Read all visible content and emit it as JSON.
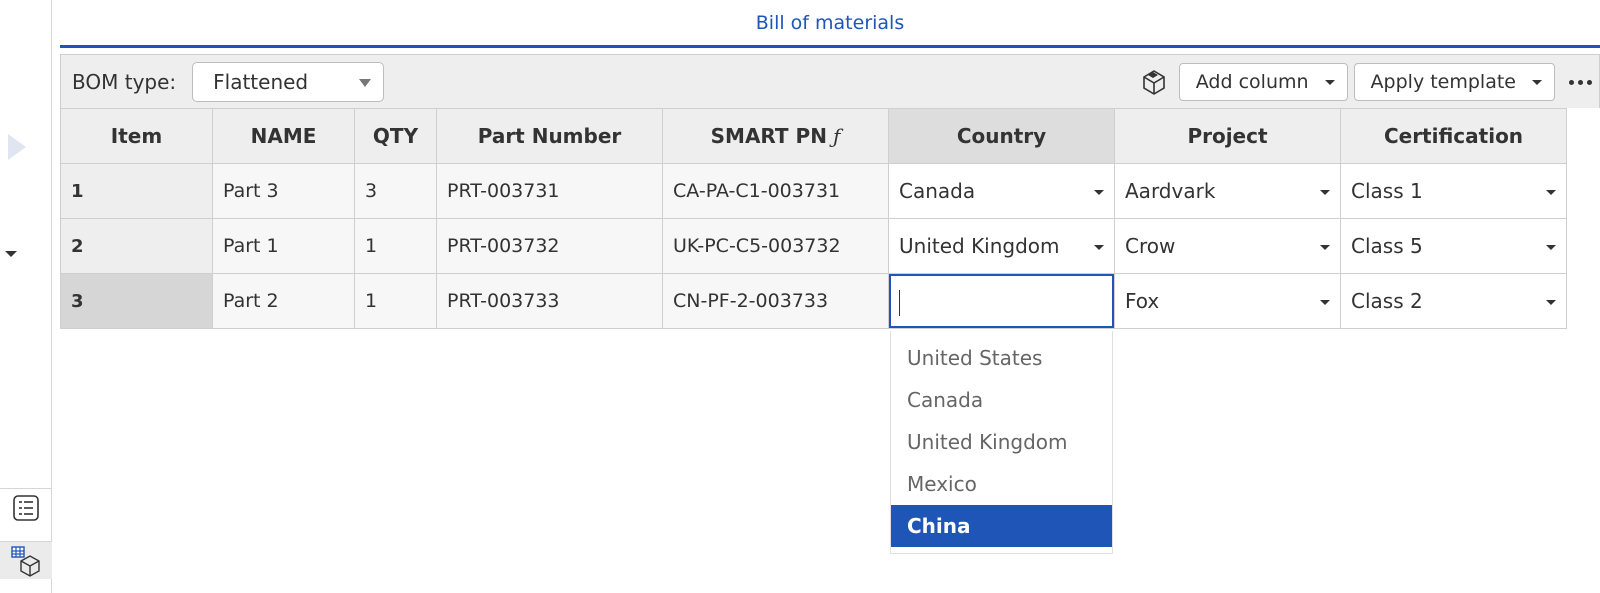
{
  "panel": {
    "title": "Bill of materials"
  },
  "toolbar": {
    "bom_type_label": "BOM type:",
    "bom_type_value": "Flattened",
    "add_column_label": "Add column",
    "apply_template_label": "Apply template"
  },
  "table": {
    "headers": {
      "item": "Item",
      "name": "NAME",
      "qty": "QTY",
      "part_number": "Part Number",
      "smart_pn": "SMART PN",
      "smart_pn_symbol": "ƒ",
      "country": "Country",
      "project": "Project",
      "certification": "Certification"
    },
    "rows": [
      {
        "item": "1",
        "name": "Part 3",
        "qty": "3",
        "part_number": "PRT-003731",
        "smart_pn": "CA-PA-C1-003731",
        "country": "Canada",
        "project": "Aardvark",
        "certification": "Class 1"
      },
      {
        "item": "2",
        "name": "Part 1",
        "qty": "1",
        "part_number": "PRT-003732",
        "smart_pn": "UK-PC-C5-003732",
        "country": "United Kingdom",
        "project": "Crow",
        "certification": "Class 5"
      },
      {
        "item": "3",
        "name": "Part 2",
        "qty": "1",
        "part_number": "PRT-003733",
        "smart_pn": "CN-PF-2-003733",
        "country": "",
        "project": "Fox",
        "certification": "Class 2"
      }
    ]
  },
  "country_dropdown": {
    "options": [
      "United States",
      "Canada",
      "United Kingdom",
      "Mexico",
      "China"
    ],
    "highlighted": "China"
  },
  "colors": {
    "accent": "#1e55b7",
    "header_bg": "#eeeeee",
    "border": "#cfcfcf"
  }
}
